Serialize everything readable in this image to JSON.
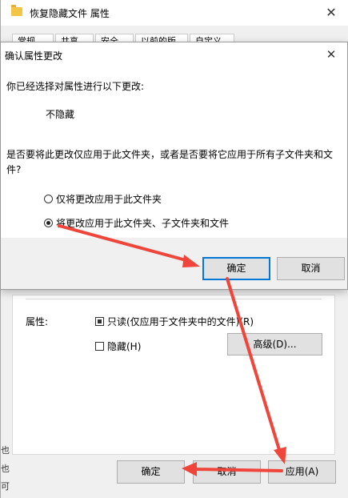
{
  "props_window": {
    "title": "恢复隐藏文件 属性",
    "close_glyph": "✕",
    "tabs": [
      "常规",
      "共享",
      "安全",
      "以前的版本",
      "自定义"
    ],
    "attributes_label": "属性:",
    "readonly_label": "只读(仅应用于文件夹中的文件)(R)",
    "readonly_checked": "partial",
    "hidden_label": "隐藏(H)",
    "hidden_checked": false,
    "advanced_button": "高级(D)...",
    "ok_button": "确定",
    "cancel_button": "取消",
    "apply_button": "应用(A)",
    "side_chars": [
      "也",
      "也",
      "可"
    ]
  },
  "confirm_dialog": {
    "title": "确认属性更改",
    "close_glyph": "✕",
    "intro": "你已经选择对属性进行以下更改:",
    "change": "不隐藏",
    "question_line1": "是否要将此更改仅应用于此文件夹，或者是否要将它应用于所有子文件夹和文",
    "question_line2": "件?",
    "option_this_folder": "仅将更改应用于此文件夹",
    "option_all": "将更改应用于此文件夹、子文件夹和文件",
    "selected_option": "all",
    "ok_button": "确定",
    "cancel_button": "取消"
  },
  "annotation_color": "#f0453a"
}
